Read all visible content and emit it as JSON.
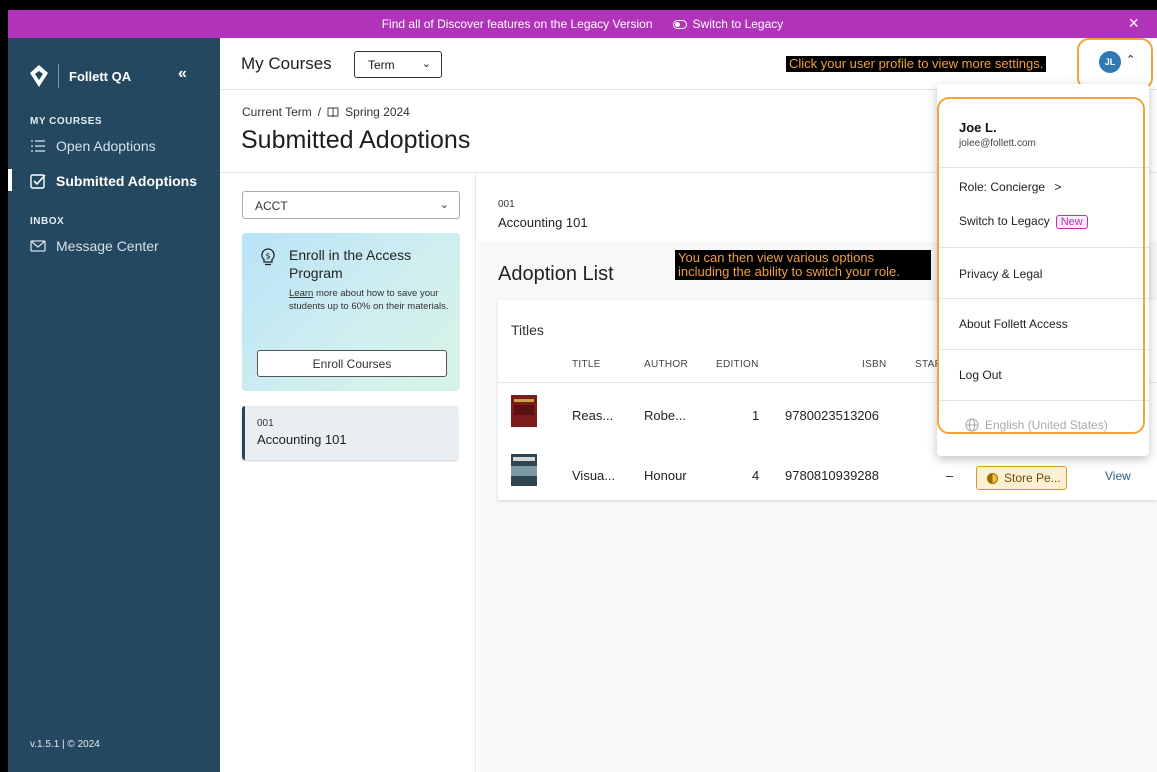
{
  "banner": {
    "message": "Find all of Discover features on the Legacy Version",
    "switch_label": "Switch to Legacy",
    "close_label": "×"
  },
  "sidebar": {
    "brand": "Follett QA",
    "collapse_label": "«",
    "sections": [
      {
        "label": "MY COURSES",
        "items": [
          {
            "label": "Open Adoptions",
            "icon": "list-icon"
          },
          {
            "label": "Submitted Adoptions",
            "icon": "checkbox-icon",
            "active": true
          }
        ]
      },
      {
        "label": "INBOX",
        "items": [
          {
            "label": "Message Center",
            "icon": "mail-icon"
          }
        ]
      }
    ],
    "version": "v.1.5.1 | © 2024"
  },
  "header": {
    "title": "My Courses",
    "term_select_value": "Term",
    "callout": "Click your user profile to view more settings.",
    "avatar_initials": "JL"
  },
  "page": {
    "breadcrumb_root": "Current Term",
    "breadcrumb_separator": "/",
    "breadcrumb_current": "Spring 2024",
    "title": "Submitted Adoptions"
  },
  "left_panel": {
    "department_select_value": "ACCT",
    "enroll_card": {
      "heading": "Enroll in the Access Program",
      "learn_link": "Learn",
      "description": " more about how to save your students up to 60% on their materials.",
      "button_label": "Enroll Courses"
    },
    "course": {
      "code": "001",
      "name": "Accounting 101"
    }
  },
  "main": {
    "course_code": "001",
    "course_name": "Accounting 101",
    "section_title": "Adoption List",
    "callout": "You can then view various options including the ability to switch your role.",
    "titles_label": "Titles",
    "columns": [
      "TITLE",
      "AUTHOR",
      "EDITION",
      "ISBN",
      "START"
    ],
    "rows": [
      {
        "title": "Reas...",
        "author": "Robe...",
        "edition": "1",
        "isbn": "9780023513206"
      },
      {
        "title": "Visua...",
        "author": "Honour",
        "edition": "4",
        "isbn": "9780810939288",
        "start": "–",
        "status": "Store Pe...",
        "action": "View"
      }
    ]
  },
  "profile_menu": {
    "user_name": "Joe L.",
    "user_email": "jolee@follett.com",
    "role_label": "Role: Concierge",
    "role_arrow": ">",
    "switch_label": "Switch to Legacy",
    "new_badge": "New",
    "privacy": "Privacy & Legal",
    "about": "About Follett Access",
    "logout": "Log Out",
    "language": "English (United States)"
  },
  "colors": {
    "banner": "#b133b9",
    "sidebar": "#24485f",
    "accent": "#2e78b4",
    "callout_ring": "#f2a43a",
    "status_badge": "#d79b25"
  }
}
